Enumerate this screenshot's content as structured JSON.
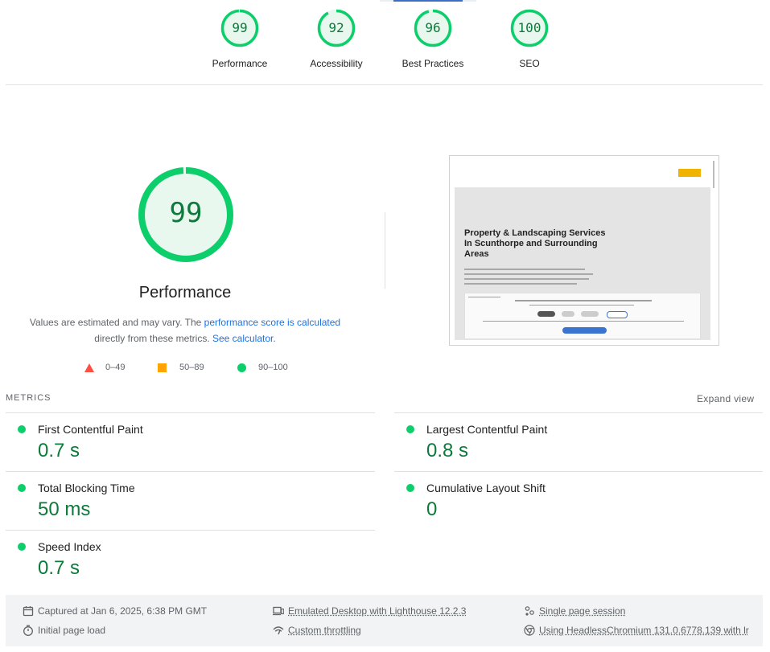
{
  "categories": [
    {
      "score": "99",
      "label": "Performance",
      "color": "#0cce6b",
      "fraction": 0.99
    },
    {
      "score": "92",
      "label": "Accessibility",
      "color": "#0cce6b",
      "fraction": 0.92
    },
    {
      "score": "96",
      "label": "Best Practices",
      "color": "#0cce6b",
      "fraction": 0.96
    },
    {
      "score": "100",
      "label": "SEO",
      "color": "#0cce6b",
      "fraction": 1.0
    }
  ],
  "performance": {
    "score": "99",
    "fraction": 0.99,
    "title": "Performance",
    "note_before": "Values are estimated and may vary. The ",
    "note_link1": "performance score is calculated",
    "note_middle": " directly from these metrics. ",
    "note_link2": "See calculator."
  },
  "legend": [
    {
      "range": "0–49",
      "shape": "triangle",
      "color": "#ff4e42"
    },
    {
      "range": "50–89",
      "shape": "square",
      "color": "#ffa400"
    },
    {
      "range": "90–100",
      "shape": "circle",
      "color": "#0cce6b"
    }
  ],
  "thumbnail": {
    "headline": "Property & Landscaping Services In Scunthorpe and Surrounding Areas"
  },
  "metrics": {
    "header": "METRICS",
    "expand": "Expand view",
    "items": [
      {
        "name": "First Contentful Paint",
        "value": "0.7 s"
      },
      {
        "name": "Largest Contentful Paint",
        "value": "0.8 s"
      },
      {
        "name": "Total Blocking Time",
        "value": "50 ms"
      },
      {
        "name": "Cumulative Layout Shift",
        "value": "0"
      },
      {
        "name": "Speed Index",
        "value": "0.7 s"
      }
    ]
  },
  "footer": {
    "captured": "Captured at Jan 6, 2025, 6:38 PM GMT",
    "initial": "Initial page load",
    "emulated": "Emulated Desktop with Lighthouse 12.2.3",
    "throttling": "Custom throttling",
    "session": "Single page session",
    "browser": "Using HeadlessChromium 131.0.6778.139 with lr"
  },
  "icons": {
    "calendar": "calendar-icon",
    "timer": "timer-icon",
    "device": "desktop-device-icon",
    "network": "network-throttling-icon",
    "session": "session-icon",
    "chrome": "chrome-icon"
  }
}
